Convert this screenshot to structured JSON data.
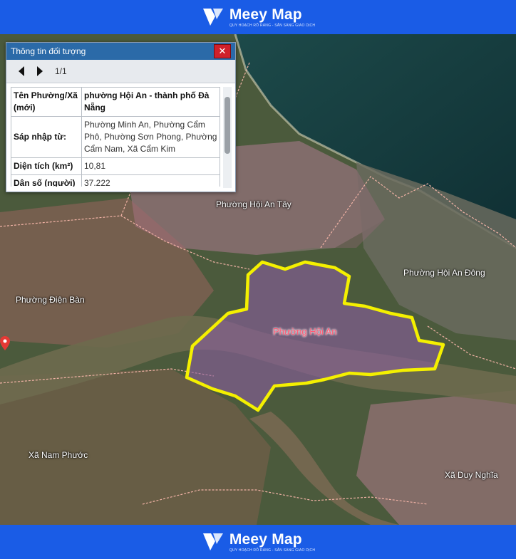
{
  "brand": {
    "name": "Meey Map",
    "tagline": "QUY HOẠCH RÕ RÀNG - SẴN SÀNG GIAO DỊCH"
  },
  "panel": {
    "title": "Thông tin đối tượng",
    "close_icon": "close-icon",
    "pagination": "1/1",
    "rows": [
      {
        "label": "Tên Phường/Xã (mới)",
        "value": "phường Hội An - thành phố Đà Nẵng"
      },
      {
        "label": "Sáp nhập từ:",
        "value": "Phường Minh An, Phường Cẩm Phô, Phường Sơn Phong, Phường Cẩm Nam, Xã Cẩm Kim"
      },
      {
        "label": "Diện tích (km²)",
        "value": "10,81"
      },
      {
        "label": "Dân số (người)",
        "value": "37.222"
      }
    ]
  },
  "map": {
    "labels": {
      "hoi_an_tay": "Phường Hội An Tây",
      "dien_ban": "Phường Điện Bàn",
      "hoi_an_dong": "Phường Hội An Đông",
      "hoi_an": "Phường Hội An",
      "nam_phuoc": "Xã Nam Phước",
      "duy_nghia": "Xã Duy Nghĩa"
    },
    "highlight_color": "#f4f000",
    "pin_color": "#e53935"
  }
}
